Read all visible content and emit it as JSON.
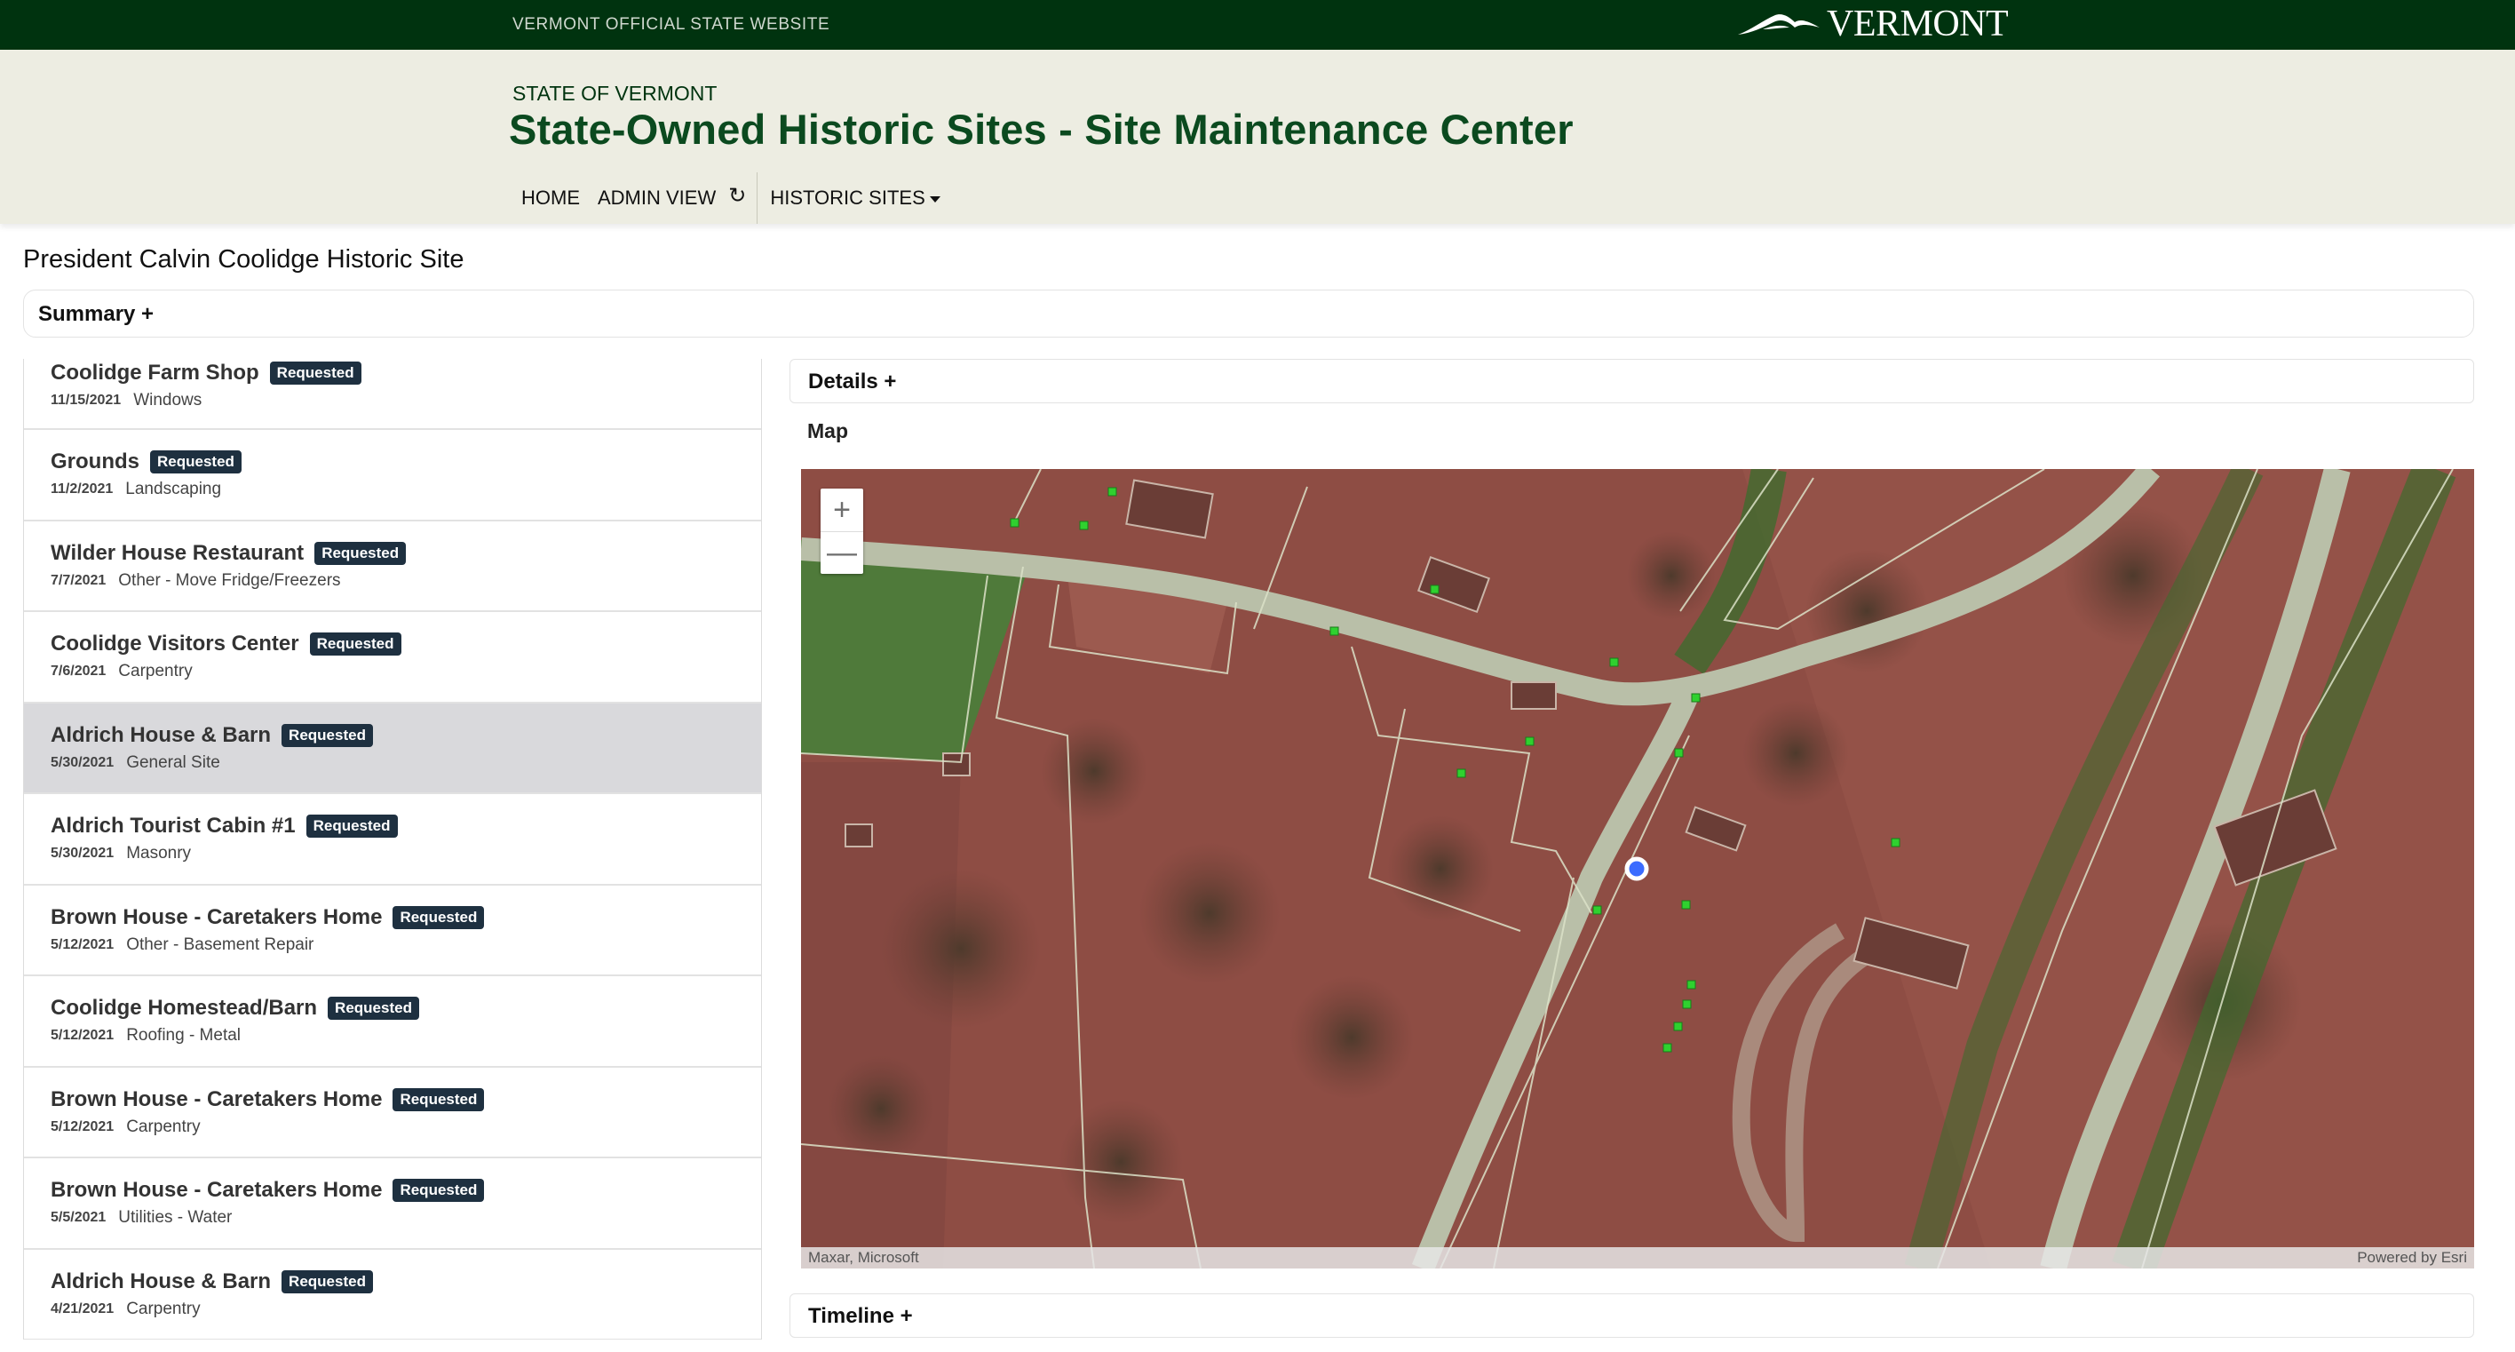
{
  "topbar": {
    "official": "VERMONT OFFICIAL STATE WEBSITE",
    "logo_text": "VERMONT"
  },
  "header": {
    "state": "STATE OF VERMONT",
    "title": "State-Owned Historic Sites - Site Maintenance Center",
    "nav": {
      "home": "HOME",
      "admin": "ADMIN VIEW",
      "sites": "HISTORIC SITES"
    }
  },
  "page": {
    "site_title": "President Calvin Coolidge Historic Site",
    "summary": "Summary +",
    "details": "Details +",
    "map_label": "Map",
    "timeline": "Timeline +"
  },
  "requests": [
    {
      "name": "Coolidge Farm Shop",
      "status": "Requested",
      "date": "11/15/2021",
      "category": "Windows"
    },
    {
      "name": "Grounds",
      "status": "Requested",
      "date": "11/2/2021",
      "category": "Landscaping"
    },
    {
      "name": "Wilder House Restaurant",
      "status": "Requested",
      "date": "7/7/2021",
      "category": "Other - Move Fridge/Freezers"
    },
    {
      "name": "Coolidge Visitors Center",
      "status": "Requested",
      "date": "7/6/2021",
      "category": "Carpentry"
    },
    {
      "name": "Aldrich House & Barn",
      "status": "Requested",
      "date": "5/30/2021",
      "category": "General Site",
      "selected": true
    },
    {
      "name": "Aldrich Tourist Cabin #1",
      "status": "Requested",
      "date": "5/30/2021",
      "category": "Masonry"
    },
    {
      "name": "Brown House - Caretakers Home",
      "status": "Requested",
      "date": "5/12/2021",
      "category": "Other - Basement Repair"
    },
    {
      "name": "Coolidge Homestead/Barn",
      "status": "Requested",
      "date": "5/12/2021",
      "category": "Roofing - Metal"
    },
    {
      "name": "Brown House - Caretakers Home",
      "status": "Requested",
      "date": "5/12/2021",
      "category": "Carpentry"
    },
    {
      "name": "Brown House - Caretakers Home",
      "status": "Requested",
      "date": "5/5/2021",
      "category": "Utilities - Water"
    },
    {
      "name": "Aldrich House & Barn",
      "status": "Requested",
      "date": "4/21/2021",
      "category": "Carpentry"
    }
  ],
  "map": {
    "zoom_in": "+",
    "zoom_out": "—",
    "attribution_left": "Maxar, Microsoft",
    "attribution_right": "Powered by Esri",
    "marker_color": "#2fd12f",
    "selected_color": "#3b6cff"
  },
  "icons": {
    "refresh": "refresh-icon",
    "caret": "caret-down-icon",
    "logo": "vermont-logo-icon"
  }
}
